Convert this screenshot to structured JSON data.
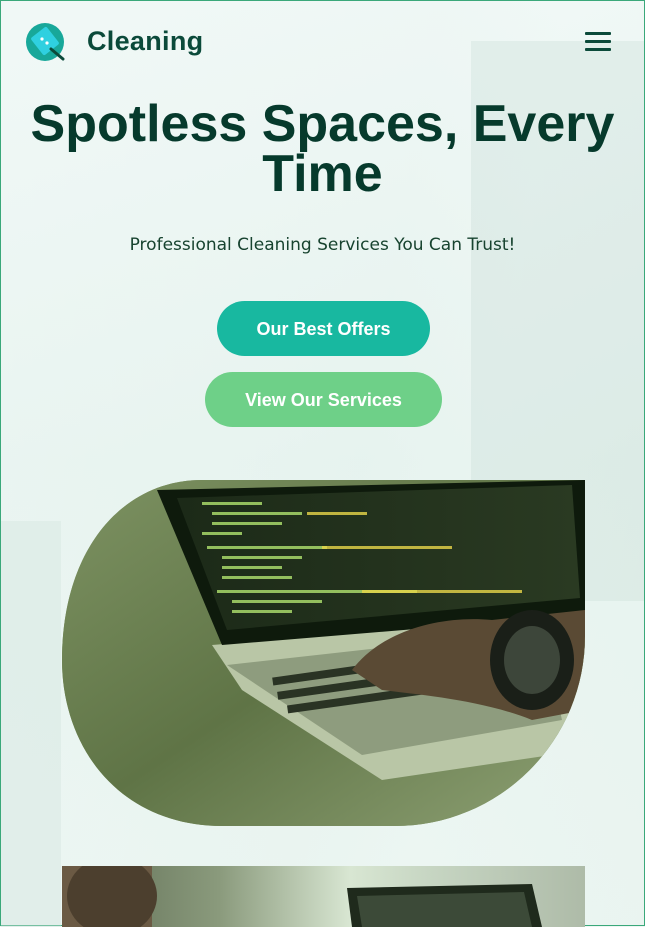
{
  "header": {
    "logo_text": "Cleaning"
  },
  "hero": {
    "title_line1": "Spotless Spaces, Every",
    "title_line2": "Time",
    "subtitle": "Professional Cleaning Services You Can Trust!",
    "primary_button": "Our Best Offers",
    "secondary_button": "View Our Services"
  },
  "colors": {
    "brand_dark": "#0b4a3a",
    "primary_button": "#18b8a0",
    "secondary_button": "#6ed088"
  },
  "icons": {
    "logo": "squeegee-logo-icon",
    "menu": "hamburger-menu-icon"
  }
}
